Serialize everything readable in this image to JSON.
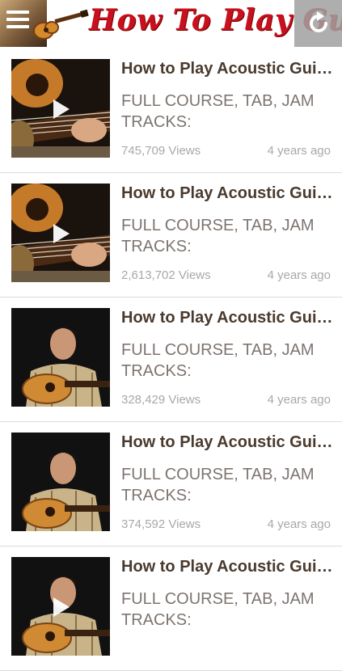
{
  "header": {
    "title": "How To Play Guitar",
    "menu_icon": "hamburger-menu-icon",
    "refresh_icon": "refresh-icon",
    "title_color": "#c8101e"
  },
  "videos": [
    {
      "title": "How to Play Acoustic Guitar",
      "description": "FULL COURSE, TAB, JAM TRACKS:",
      "views": "745,709 Views",
      "age": "4 years ago",
      "thumbnail": "guitar-closeup",
      "playing": true
    },
    {
      "title": "How to Play Acoustic Guitar",
      "description": "FULL COURSE, TAB, JAM TRACKS:",
      "views": "2,613,702 Views",
      "age": "4 years ago",
      "thumbnail": "guitar-closeup",
      "playing": true
    },
    {
      "title": "How to Play Acoustic Guitar",
      "description": "FULL COURSE, TAB, JAM TRACKS:",
      "views": "328,429 Views",
      "age": "4 years ago",
      "thumbnail": "instructor",
      "playing": false
    },
    {
      "title": "How to Play Acoustic Guitar",
      "description": "FULL COURSE, TAB, JAM TRACKS:",
      "views": "374,592 Views",
      "age": "4 years ago",
      "thumbnail": "instructor",
      "playing": false
    },
    {
      "title": "How to Play Acoustic Guitar",
      "description": "FULL COURSE, TAB, JAM TRACKS:",
      "views": "",
      "age": "",
      "thumbnail": "instructor",
      "playing": true
    }
  ],
  "colors": {
    "title_text": "#4a3a2e",
    "description_text": "#7d7470",
    "meta_text": "#a8a8a8",
    "divider": "#dcdcdc"
  }
}
